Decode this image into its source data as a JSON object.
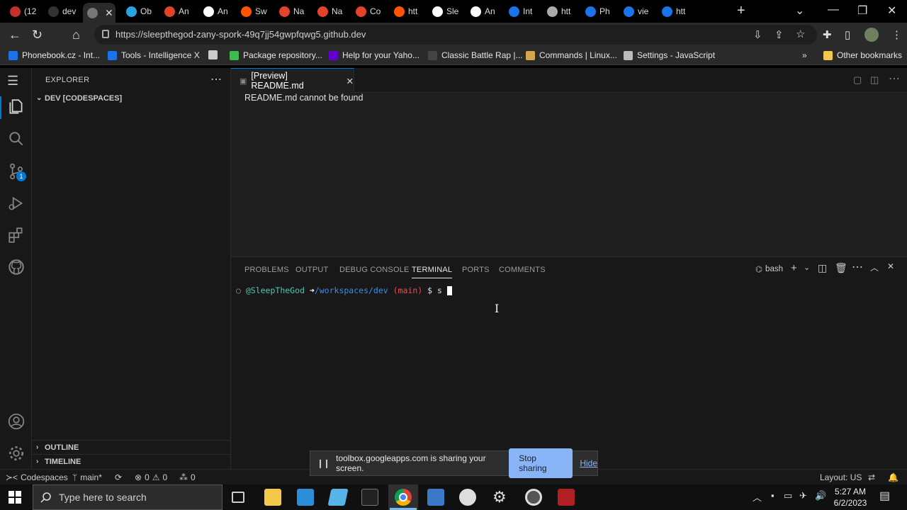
{
  "browser": {
    "tabs": [
      {
        "label": "(12",
        "color": "#c4302b"
      },
      {
        "label": "dev",
        "color": "#333333"
      },
      {
        "label": "",
        "color": "#777777",
        "active": true
      },
      {
        "label": "Ob",
        "color": "#2aa3df"
      },
      {
        "label": "An",
        "color": "#e24329"
      },
      {
        "label": "An",
        "color": "#ffffff"
      },
      {
        "label": "Sw",
        "color": "#ff5500"
      },
      {
        "label": "Na",
        "color": "#e24329"
      },
      {
        "label": "Na",
        "color": "#e24329"
      },
      {
        "label": "Co",
        "color": "#e24329"
      },
      {
        "label": "htt",
        "color": "#ff5500"
      },
      {
        "label": "Sle",
        "color": "#ffffff"
      },
      {
        "label": "An",
        "color": "#ffffff"
      },
      {
        "label": "Int",
        "color": "#1a73e8"
      },
      {
        "label": "htt",
        "color": "#aaaaaa"
      },
      {
        "label": "Ph",
        "color": "#1a73e8"
      },
      {
        "label": "vie",
        "color": "#1a73e8"
      },
      {
        "label": "htt",
        "color": "#1a73e8"
      }
    ],
    "url": "https://sleepthegod-zany-spork-49q7jj54gwpfqwg5.github.dev",
    "bookmarks": [
      {
        "label": "Phonebook.cz - Int...",
        "color": "#1a73e8"
      },
      {
        "label": "Tools - Intelligence X",
        "color": "#1a73e8"
      },
      {
        "label": "",
        "color": "#cccccc"
      },
      {
        "label": "Package repository...",
        "color": "#3fb950"
      },
      {
        "label": "Help for your Yaho...",
        "color": "#6001d2"
      },
      {
        "label": "Classic Battle Rap |...",
        "color": "#444444"
      },
      {
        "label": "Commands | Linux...",
        "color": "#d4a54a"
      },
      {
        "label": "Settings - JavaScript",
        "color": "#bbbbbb"
      }
    ],
    "other_bookmarks": "Other bookmarks"
  },
  "vscode": {
    "explorer_title": "EXPLORER",
    "workspace": "DEV [CODESPACES]",
    "outline": "OUTLINE",
    "timeline": "TIMELINE",
    "editor_tab": "[Preview] README.md",
    "editor_message": "README.md cannot be found",
    "scm_badge": "1",
    "panel_tabs": [
      "PROBLEMS",
      "OUTPUT",
      "DEBUG CONSOLE",
      "TERMINAL",
      "PORTS",
      "COMMENTS"
    ],
    "active_panel_tab": "TERMINAL",
    "shell": "bash",
    "terminal": {
      "user": "@SleepTheGod",
      "arrow": "➜",
      "path": "/workspaces/dev",
      "branch": "(main)",
      "prompt": "$ s"
    },
    "status": {
      "remote": "Codespaces",
      "branch": "main*",
      "errors": "0",
      "warnings": "0",
      "ports": "0",
      "layout": "Layout: US"
    }
  },
  "share_notice": {
    "text": "toolbox.googleapps.com is sharing your screen.",
    "stop": "Stop sharing",
    "hide": "Hide"
  },
  "taskbar": {
    "search_placeholder": "Type here to search",
    "time": "5:27 AM",
    "date": "6/2/2023"
  }
}
